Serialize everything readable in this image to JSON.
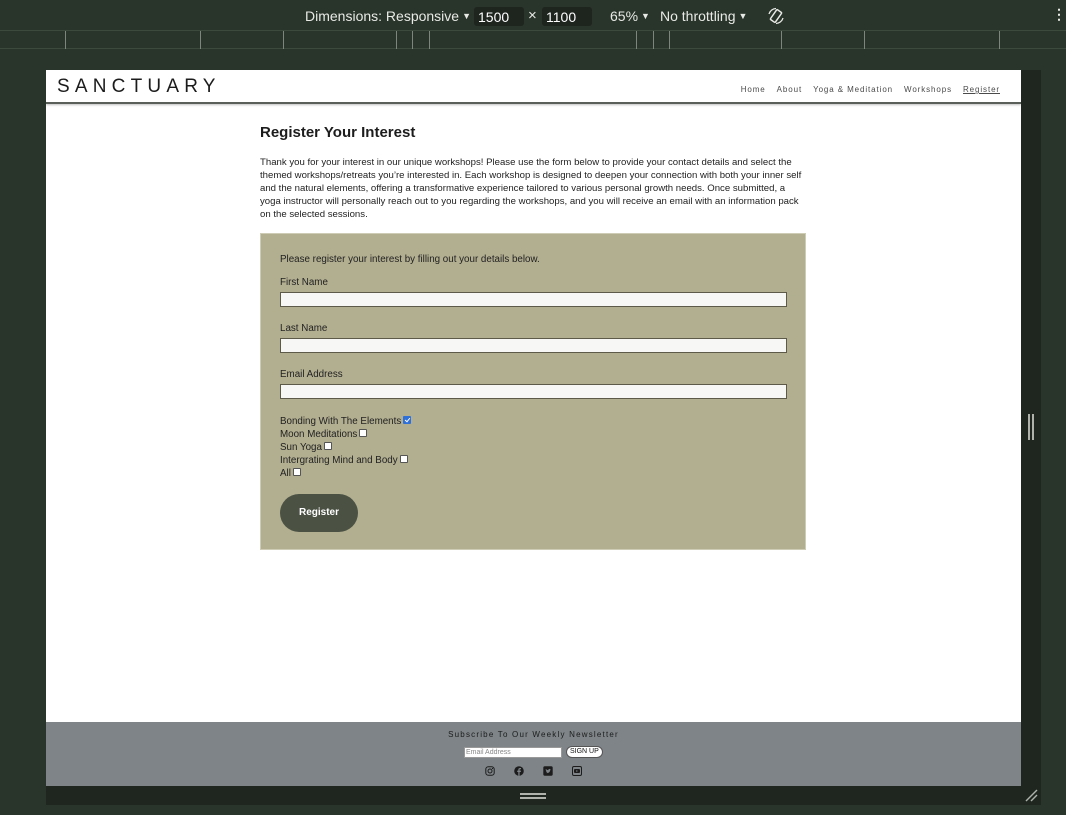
{
  "devtools": {
    "dimensions_label": "Dimensions: Responsive",
    "width": "1500",
    "height": "1100",
    "times": "×",
    "zoom": "65%",
    "throttling": "No throttling",
    "more": "⋮"
  },
  "site": {
    "logo": "SANCTUARY",
    "nav": [
      "Home",
      "About",
      "Yoga & Meditation",
      "Workshops",
      "Register"
    ],
    "active_nav": "Register"
  },
  "main": {
    "title": "Register Your Interest",
    "intro": "Thank you for your interest in our unique workshops! Please use the form below to provide your contact details and select the themed workshops/retreats you’re interested in. Each workshop is designed to deepen your connection with both your inner self and the natural elements, offering a transformative experience tailored to various personal growth needs. Once submitted, a yoga instructor will personally reach out to you regarding the workshops, and you will receive an email with an information pack on the selected sessions."
  },
  "form": {
    "lead": "Please register your interest by filling out your details below.",
    "first_name_label": "First Name",
    "last_name_label": "Last Name",
    "email_label": "Email Address",
    "workshops": [
      {
        "label": "Bonding With The Elements",
        "checked": true
      },
      {
        "label": "Moon Meditations",
        "checked": false
      },
      {
        "label": "Sun Yoga",
        "checked": false
      },
      {
        "label": "Intergrating Mind and Body",
        "checked": false
      },
      {
        "label": "All",
        "checked": false
      }
    ],
    "submit_label": "Register"
  },
  "footer": {
    "newsletter_title": "Subscribe To Our Weekly Newsletter",
    "email_placeholder": "Email Address",
    "signup_label": "SIGN UP",
    "socials": [
      "instagram-icon",
      "facebook-icon",
      "twitter-icon",
      "youtube-icon"
    ]
  },
  "colors": {
    "form_background": "#b2ae90",
    "button": "#4b5244",
    "footer": "#7e8487",
    "devtools": "#29342a"
  }
}
